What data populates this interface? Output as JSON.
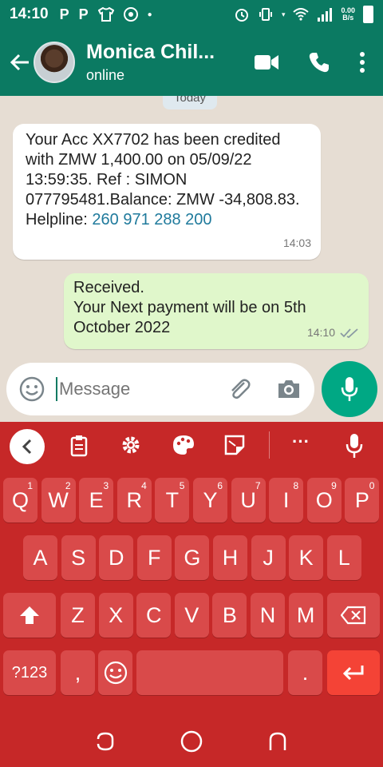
{
  "status_bar": {
    "time": "14:10",
    "left_icons": [
      "p-icon",
      "p-icon",
      "shirt-icon",
      "chrome-icon",
      "dot-icon"
    ],
    "net_speed_value": "0.00",
    "net_speed_unit": "B/s"
  },
  "header": {
    "contact_name": "Monica Chil...",
    "contact_status": "online"
  },
  "chat": {
    "date_label": "Today",
    "messages": [
      {
        "direction": "incoming",
        "text": "Your Acc XX7702 has been credited with ZMW 1,400.00 on 05/09/22 13:59:35. Ref : SIMON 077795481.Balance: ZMW -34,808.83. Helpline: ",
        "link": "260 971 288 200",
        "time": "14:03"
      },
      {
        "direction": "outgoing",
        "line1": "Received.",
        "line2": "Your Next payment will be on 5th October 2022",
        "time": "14:10",
        "read": true
      }
    ]
  },
  "input": {
    "placeholder": "Message"
  },
  "keyboard": {
    "row1": [
      {
        "k": "Q",
        "n": "1"
      },
      {
        "k": "W",
        "n": "2"
      },
      {
        "k": "E",
        "n": "3"
      },
      {
        "k": "R",
        "n": "4"
      },
      {
        "k": "T",
        "n": "5"
      },
      {
        "k": "Y",
        "n": "6"
      },
      {
        "k": "U",
        "n": "7"
      },
      {
        "k": "I",
        "n": "8"
      },
      {
        "k": "O",
        "n": "9"
      },
      {
        "k": "P",
        "n": "0"
      }
    ],
    "row2": [
      "A",
      "S",
      "D",
      "F",
      "G",
      "H",
      "J",
      "K",
      "L"
    ],
    "row3": [
      "Z",
      "X",
      "C",
      "V",
      "B",
      "N",
      "M"
    ],
    "symbols_label": "?123",
    "comma": ",",
    "period": "."
  },
  "colors": {
    "header": "#0b7a62",
    "keyboard": "#c62828",
    "outgoing_bubble": "#e0f7cb",
    "mic_button": "#00a884"
  }
}
